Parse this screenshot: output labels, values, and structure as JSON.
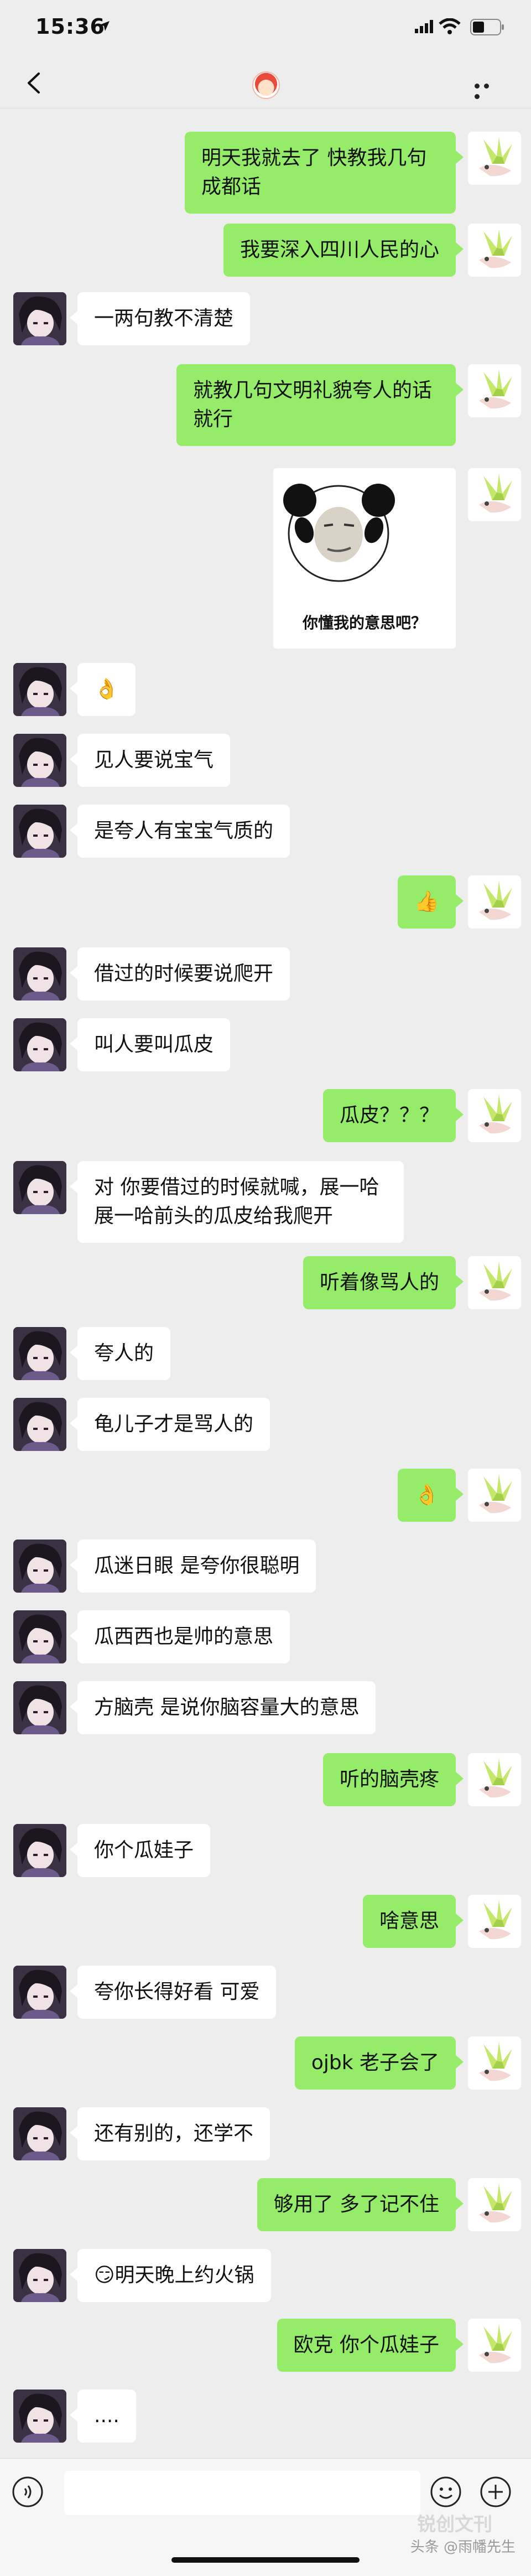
{
  "status_bar": {
    "time": "15:36"
  },
  "sticker": {
    "caption": "你懂我的意思吧？"
  },
  "messages": [
    {
      "from": "me",
      "text": "明天我就去了 快教我几句成都话"
    },
    {
      "from": "me",
      "text": "我要深入四川人民的心"
    },
    {
      "from": "other",
      "text": "一两句教不清楚"
    },
    {
      "from": "me",
      "text": "就教几句文明礼貌夸人的话就行"
    },
    {
      "from": "me",
      "type": "sticker"
    },
    {
      "from": "other",
      "text": "👌"
    },
    {
      "from": "other",
      "text": "见人要说宝气"
    },
    {
      "from": "other",
      "text": "是夸人有宝宝气质的"
    },
    {
      "from": "me",
      "text": "👍"
    },
    {
      "from": "other",
      "text": "借过的时候要说爬开"
    },
    {
      "from": "other",
      "text": "叫人要叫瓜皮"
    },
    {
      "from": "me",
      "text": "瓜皮？？？"
    },
    {
      "from": "other",
      "text": "对 你要借过的时候就喊，展一哈展一哈前头的瓜皮给我爬开"
    },
    {
      "from": "me",
      "text": "听着像骂人的"
    },
    {
      "from": "other",
      "text": "夸人的"
    },
    {
      "from": "other",
      "text": "龟儿子才是骂人的"
    },
    {
      "from": "me",
      "text": "👌"
    },
    {
      "from": "other",
      "text": "瓜迷日眼 是夸你很聪明"
    },
    {
      "from": "other",
      "text": "瓜西西也是帅的意思"
    },
    {
      "from": "other",
      "text": "方脑壳 是说你脑容量大的意思"
    },
    {
      "from": "me",
      "text": "听的脑壳疼"
    },
    {
      "from": "other",
      "text": "你个瓜娃子"
    },
    {
      "from": "me",
      "text": "啥意思"
    },
    {
      "from": "other",
      "text": "夸你长得好看 可爱"
    },
    {
      "from": "me",
      "text": "ojbk 老子会了"
    },
    {
      "from": "other",
      "text": "还有别的，还学不"
    },
    {
      "from": "me",
      "text": "够用了 多了记不住"
    },
    {
      "from": "other",
      "text": "😏明天晚上约火锅"
    },
    {
      "from": "me",
      "text": "欧克 你个瓜娃子"
    },
    {
      "from": "other",
      "text": "...."
    }
  ],
  "watermark": {
    "text": "头条 @雨幡先生",
    "logo_text": "锐创文刊"
  },
  "icons": [
    "back-arrow-icon",
    "more-dots-icon",
    "voice-icon",
    "emoji-icon",
    "plus-icon",
    "signal-icon",
    "wifi-icon",
    "battery-icon",
    "location-arrow-icon"
  ]
}
